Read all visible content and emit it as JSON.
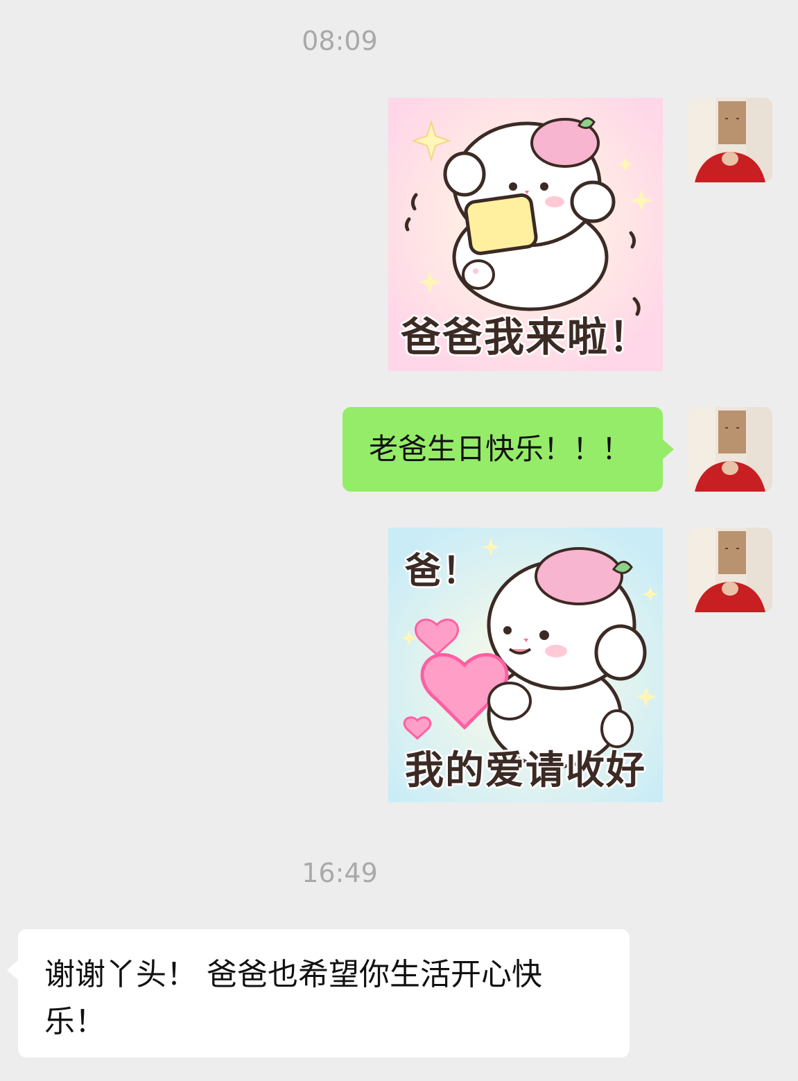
{
  "timestamps": {
    "first": "08:09",
    "second": "16:49"
  },
  "messages": {
    "sticker1_caption": "爸爸我来啦！",
    "text1": "老爸生日快乐！！！",
    "sticker2_top": "爸！",
    "sticker2_caption": "我的爱请收好",
    "reply": "谢谢丫头！ 爸爸也希望你生活开心快乐！"
  },
  "icons": {
    "avatar": "user-avatar-photo",
    "sticker1": "bunny-eating-bread-sticker",
    "sticker2": "bunny-holding-heart-sticker"
  },
  "colors": {
    "background": "#ededed",
    "outgoing_bubble": "#95ec69",
    "incoming_bubble": "#ffffff",
    "timestamp": "#a9a9a9"
  }
}
